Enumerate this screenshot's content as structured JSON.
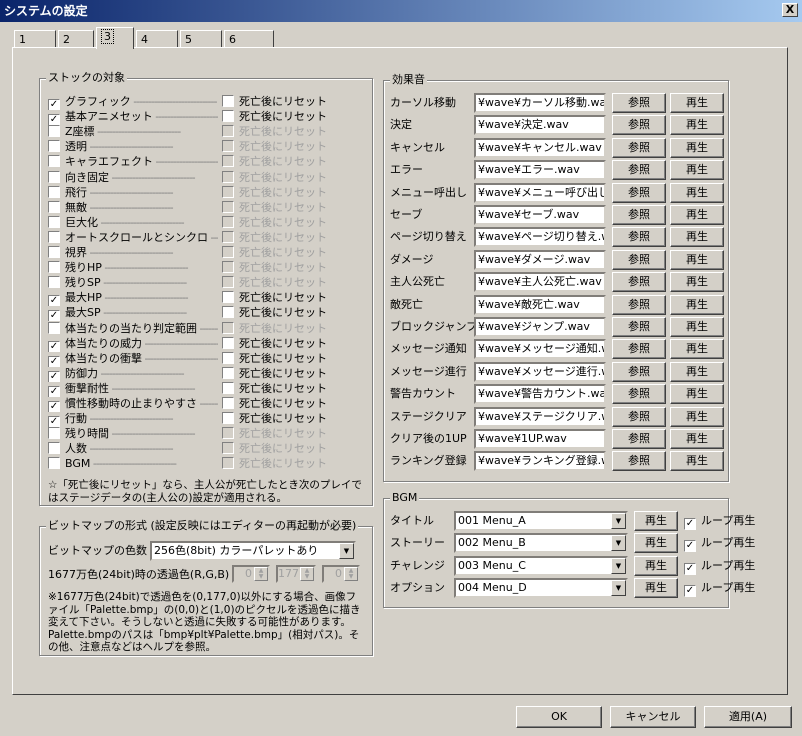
{
  "window": {
    "title": "システムの設定",
    "close_label": "X"
  },
  "tabs": [
    "1",
    "2",
    "3",
    "4",
    "5",
    "6"
  ],
  "stock": {
    "title": "ストックの対象",
    "items": [
      {
        "label": "グラフィック",
        "checked": true,
        "enabled": true,
        "reset_checked": false,
        "reset_enabled": true
      },
      {
        "label": "基本アニメセット",
        "checked": true,
        "enabled": true,
        "reset_checked": false,
        "reset_enabled": true
      },
      {
        "label": "Z座標",
        "checked": false,
        "enabled": true,
        "reset_checked": false,
        "reset_enabled": false
      },
      {
        "label": "透明",
        "checked": false,
        "enabled": true,
        "reset_checked": false,
        "reset_enabled": false
      },
      {
        "label": "キャラエフェクト",
        "checked": false,
        "enabled": true,
        "reset_checked": false,
        "reset_enabled": false
      },
      {
        "label": "向き固定",
        "checked": false,
        "enabled": true,
        "reset_checked": false,
        "reset_enabled": false
      },
      {
        "label": "飛行",
        "checked": false,
        "enabled": true,
        "reset_checked": false,
        "reset_enabled": false
      },
      {
        "label": "無敵",
        "checked": false,
        "enabled": true,
        "reset_checked": false,
        "reset_enabled": false
      },
      {
        "label": "巨大化",
        "checked": false,
        "enabled": true,
        "reset_checked": false,
        "reset_enabled": false
      },
      {
        "label": "オートスクロールとシンクロ",
        "checked": false,
        "enabled": true,
        "reset_checked": false,
        "reset_enabled": false
      },
      {
        "label": "視界",
        "checked": false,
        "enabled": true,
        "reset_checked": false,
        "reset_enabled": false
      },
      {
        "label": "残りHP",
        "checked": false,
        "enabled": true,
        "reset_checked": false,
        "reset_enabled": false
      },
      {
        "label": "残りSP",
        "checked": false,
        "enabled": true,
        "reset_checked": false,
        "reset_enabled": false
      },
      {
        "label": "最大HP",
        "checked": true,
        "enabled": true,
        "reset_checked": false,
        "reset_enabled": true
      },
      {
        "label": "最大SP",
        "checked": true,
        "enabled": true,
        "reset_checked": false,
        "reset_enabled": true
      },
      {
        "label": "体当たりの当たり判定範囲",
        "checked": false,
        "enabled": true,
        "reset_checked": false,
        "reset_enabled": false
      },
      {
        "label": "体当たりの威力",
        "checked": true,
        "enabled": true,
        "reset_checked": false,
        "reset_enabled": true
      },
      {
        "label": "体当たりの衝撃",
        "checked": true,
        "enabled": true,
        "reset_checked": false,
        "reset_enabled": true
      },
      {
        "label": "防御力",
        "checked": true,
        "enabled": true,
        "reset_checked": false,
        "reset_enabled": true
      },
      {
        "label": "衝撃耐性",
        "checked": true,
        "enabled": true,
        "reset_checked": false,
        "reset_enabled": true
      },
      {
        "label": "慣性移動時の止まりやすさ",
        "checked": true,
        "enabled": true,
        "reset_checked": false,
        "reset_enabled": true
      },
      {
        "label": "行動",
        "checked": true,
        "enabled": true,
        "reset_checked": false,
        "reset_enabled": true
      },
      {
        "label": "残り時間",
        "checked": false,
        "enabled": true,
        "reset_checked": false,
        "reset_enabled": false
      },
      {
        "label": "人数",
        "checked": false,
        "enabled": true,
        "reset_checked": false,
        "reset_enabled": false
      },
      {
        "label": "BGM",
        "checked": false,
        "enabled": true,
        "reset_checked": false,
        "reset_enabled": false
      }
    ],
    "reset_label": "死亡後にリセット",
    "note": "☆「死亡後にリセット」なら、主人公が死亡したとき次のプレイではステージデータの(主人公の)設定が適用される。"
  },
  "bitmap": {
    "title": "ビットマップの形式 (設定反映にはエディターの再起動が必要)",
    "color_label": "ビットマップの色数",
    "color_value": "256色(8bit) カラーパレットあり",
    "trans_label": "1677万色(24bit)時の透過色(R,G,B)",
    "r": "0",
    "g": "177",
    "b": "0",
    "note": "※1677万色(24bit)で透過色を(0,177,0)以外にする場合、画像ファイル「Palette.bmp」の(0,0)と(1,0)のピクセルを透過色に描き変えて下さい。そうしないと透過に失敗する可能性があります。Palette.bmpのパスは「bmp¥plt¥Palette.bmp」(相対パス)。その他、注意点などはヘルプを参照。"
  },
  "sound": {
    "title": "効果音",
    "browse_label": "参照",
    "play_label": "再生",
    "items": [
      {
        "label": "カーソル移動",
        "file": "¥wave¥カーソル移動.wav"
      },
      {
        "label": "決定",
        "file": "¥wave¥決定.wav"
      },
      {
        "label": "キャンセル",
        "file": "¥wave¥キャンセル.wav"
      },
      {
        "label": "エラー",
        "file": "¥wave¥エラー.wav"
      },
      {
        "label": "メニュー呼出し",
        "file": "¥wave¥メニュー呼び出し"
      },
      {
        "label": "セーブ",
        "file": "¥wave¥セーブ.wav"
      },
      {
        "label": "ページ切り替え",
        "file": "¥wave¥ページ切り替え.w"
      },
      {
        "label": "ダメージ",
        "file": "¥wave¥ダメージ.wav"
      },
      {
        "label": "主人公死亡",
        "file": "¥wave¥主人公死亡.wav"
      },
      {
        "label": "敵死亡",
        "file": "¥wave¥敵死亡.wav"
      },
      {
        "label": "ブロックジャンプ",
        "file": "¥wave¥ジャンプ.wav"
      },
      {
        "label": "メッセージ通知",
        "file": "¥wave¥メッセージ通知.wa"
      },
      {
        "label": "メッセージ進行",
        "file": "¥wave¥メッセージ進行.wa"
      },
      {
        "label": "警告カウント",
        "file": "¥wave¥警告カウント.wav"
      },
      {
        "label": "ステージクリア",
        "file": "¥wave¥ステージクリア.wa"
      },
      {
        "label": "クリア後の1UP",
        "file": "¥wave¥1UP.wav"
      },
      {
        "label": "ランキング登録",
        "file": "¥wave¥ランキング登録.wa"
      }
    ]
  },
  "bgm": {
    "title": "BGM",
    "play_label": "再生",
    "loop_label": "ループ再生",
    "items": [
      {
        "label": "タイトル",
        "value": "001 Menu_A",
        "loop": true
      },
      {
        "label": "ストーリー",
        "value": "002 Menu_B",
        "loop": true
      },
      {
        "label": "チャレンジ",
        "value": "003 Menu_C",
        "loop": true
      },
      {
        "label": "オプション",
        "value": "004 Menu_D",
        "loop": true
      }
    ]
  },
  "buttons": {
    "ok": "OK",
    "cancel": "キャンセル",
    "apply": "適用(A)"
  }
}
